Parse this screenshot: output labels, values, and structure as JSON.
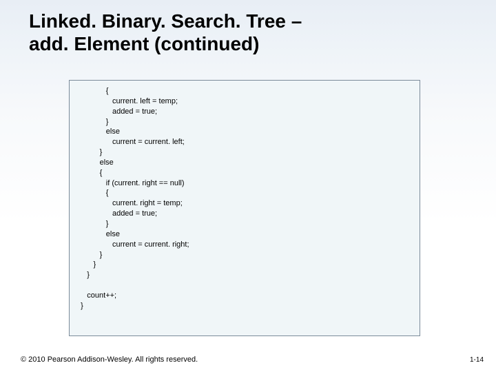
{
  "title_line1": "Linked. Binary. Search. Tree –",
  "title_line2": "add. Element (continued)",
  "code": "              {\n                 current. left = temp;\n                 added = true;\n              }\n              else\n                 current = current. left;\n           }\n           else\n           {\n              if (current. right == null)\n              {\n                 current. right = temp;\n                 added = true;\n              }\n              else\n                 current = current. right;\n           }\n        }\n     }\n\n     count++;\n  }",
  "footer": "© 2010 Pearson Addison-Wesley. All rights reserved.",
  "pagenum": "1-14"
}
